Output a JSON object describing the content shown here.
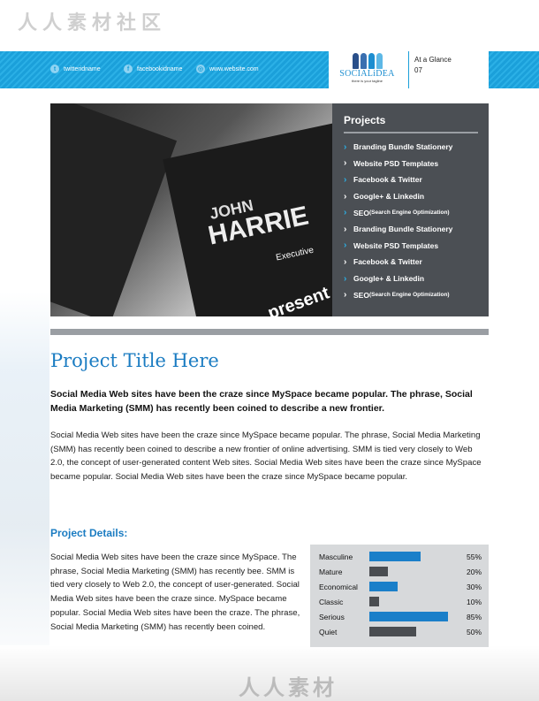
{
  "watermarks": {
    "top": "人人素材社区",
    "bottom": "人人素材"
  },
  "header": {
    "contacts": [
      {
        "icon": "twitter-icon",
        "label": "twitteridname"
      },
      {
        "icon": "facebook-icon",
        "label": "facebookidname"
      },
      {
        "icon": "globe-icon",
        "label": "www.website.com"
      }
    ],
    "logo": {
      "name": "SOCIALiDEA",
      "tagline": "there is your tagline"
    },
    "glance": {
      "label": "At a Glance",
      "page": "07"
    }
  },
  "colors": {
    "accent": "#1ba0da",
    "title": "#1b7cc2",
    "panel": "#4b4f54",
    "bar_blue": "#1a7fc9",
    "bar_gray": "#4a4d51"
  },
  "photo": {
    "first": "JOHN",
    "last": "HARRIE",
    "role": "Executive",
    "brand": "present"
  },
  "projects": {
    "title": "Projects",
    "items": [
      {
        "main": "Branding Bundle Stationery",
        "sub": ""
      },
      {
        "main": "Website PSD Templates",
        "sub": ""
      },
      {
        "main": "Facebook & Twitter",
        "sub": ""
      },
      {
        "main": "Google+ & Linkedin",
        "sub": ""
      },
      {
        "main": "SEO ",
        "sub": "(Search Engine Optimization)"
      },
      {
        "main": "Branding Bundle Stationery",
        "sub": ""
      },
      {
        "main": "Website PSD Templates",
        "sub": ""
      },
      {
        "main": "Facebook & Twitter",
        "sub": ""
      },
      {
        "main": "Google+ & Linkedin",
        "sub": ""
      },
      {
        "main": "SEO ",
        "sub": "(Search Engine Optimization)"
      }
    ]
  },
  "main": {
    "title": "Project Title Here",
    "lead": "Social Media Web sites have been the craze since MySpace became popular. The phrase, Social Media Marketing (SMM) has recently been coined to describe a new frontier.",
    "body": "Social Media Web sites have been the craze since MySpace became popular. The phrase, Social Media Marketing (SMM) has recently been coined to describe a new frontier of online advertising. SMM is tied very closely to Web 2.0, the concept of user-generated content Web sites.  Social Media Web sites have been the craze since MySpace became popular. Social Media Web sites have been the craze since MySpace became popular.",
    "details_title": "Project Details:",
    "details_text": "Social Media Web sites have been the craze since MySpace. The phrase, Social Media Marketing (SMM) has recently bee. SMM is tied very closely to Web 2.0, the concept of user-generated. Social Media Web sites have been the craze since. MySpace became popular. Social Media Web sites have been the craze. The phrase, Social Media Marketing (SMM) has recently been coined."
  },
  "chart_data": {
    "type": "bar",
    "orientation": "horizontal",
    "categories": [
      "Masculine",
      "Mature",
      "Economical",
      "Classic",
      "Serious",
      "Quiet"
    ],
    "values": [
      55,
      20,
      30,
      10,
      85,
      50
    ],
    "value_labels": [
      "55%",
      "20%",
      "30%",
      "10%",
      "85%",
      "50%"
    ],
    "bar_colors": [
      "#1a7fc9",
      "#4a4d51",
      "#1a7fc9",
      "#4a4d51",
      "#1a7fc9",
      "#4a4d51"
    ],
    "xlim": [
      0,
      100
    ]
  }
}
